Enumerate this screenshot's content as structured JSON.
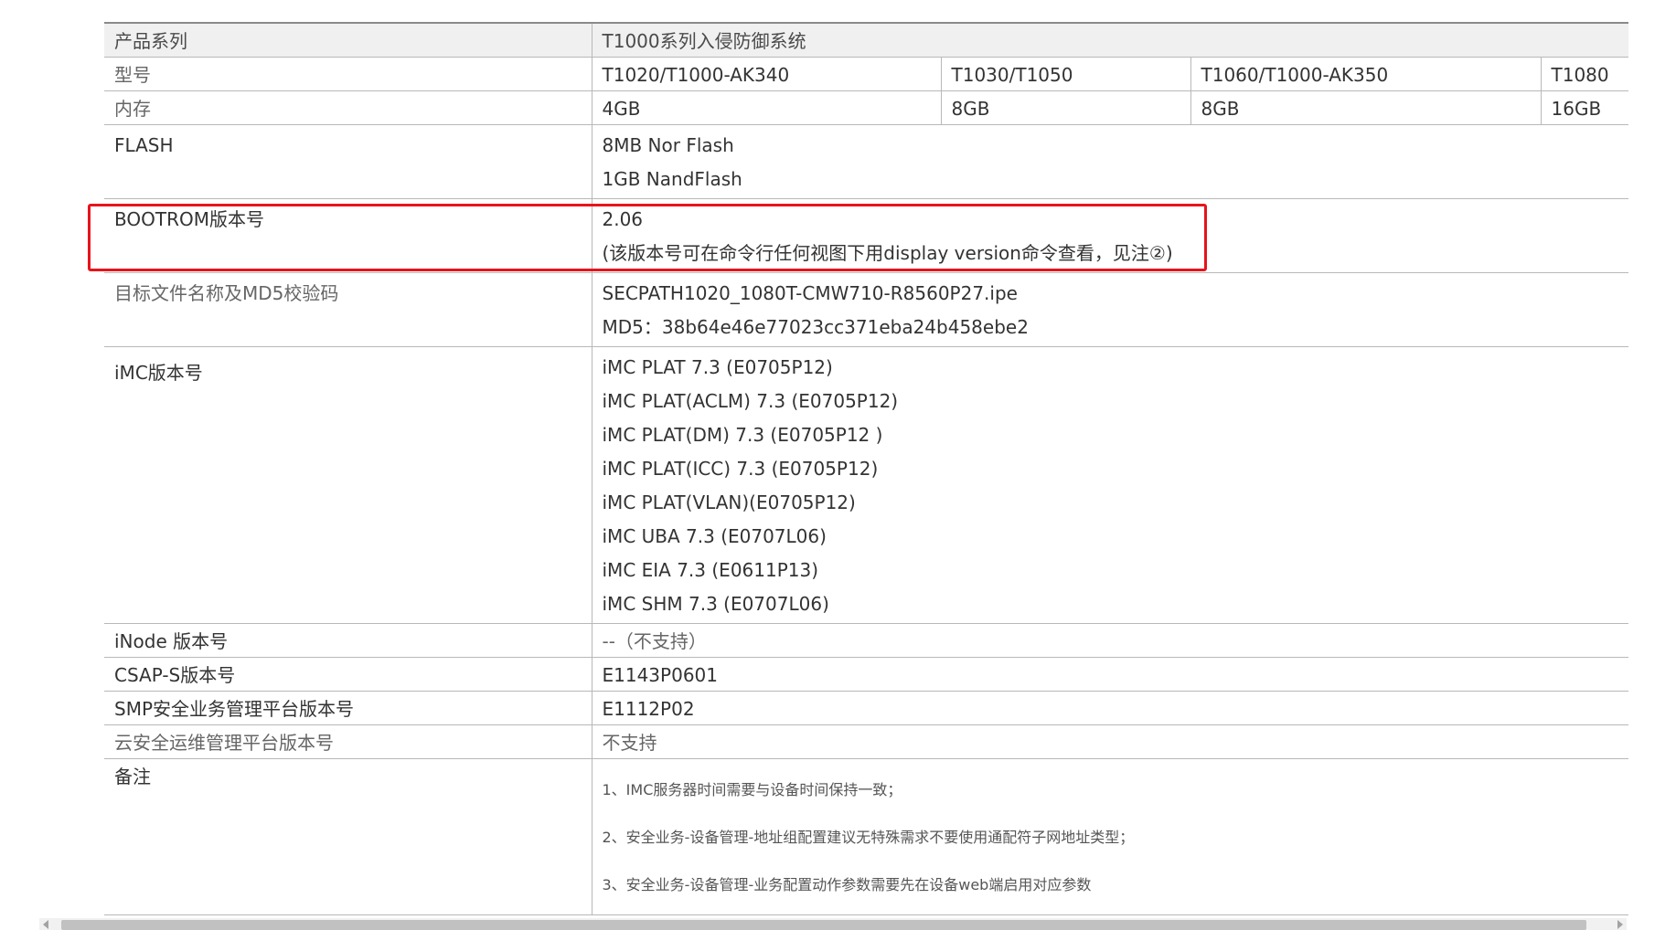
{
  "table": {
    "header": {
      "label": "产品系列",
      "value": "T1000系列入侵防御系统"
    },
    "model": {
      "label": "型号",
      "values": [
        "T1020/T1000-AK340",
        "T1030/T1050",
        "T1060/T1000-AK350",
        "T1080"
      ]
    },
    "memory": {
      "label": "内存",
      "values": [
        "4GB",
        "8GB",
        "8GB",
        "16GB"
      ]
    },
    "flash": {
      "label": "FLASH",
      "lines": [
        "8MB Nor Flash",
        "1GB NandFlash"
      ]
    },
    "bootrom": {
      "label": "BOOTROM版本号",
      "lines": [
        "2.06",
        "(该版本号可在命令行任何视图下用display version命令查看，见注②)"
      ]
    },
    "target_file": {
      "label": "目标文件名称及MD5校验码",
      "lines": [
        "SECPATH1020_1080T-CMW710-R8560P27.ipe",
        "MD5：38b64e46e77023cc371eba24b458ebe2"
      ]
    },
    "imc": {
      "label": "iMC版本号",
      "lines": [
        "iMC PLAT 7.3 (E0705P12)",
        "iMC PLAT(ACLM) 7.3 (E0705P12)",
        "iMC PLAT(DM) 7.3 (E0705P12 )",
        "iMC PLAT(ICC) 7.3 (E0705P12)",
        "iMC PLAT(VLAN)(E0705P12)",
        "iMC UBA 7.3 (E0707L06)",
        "iMC EIA 7.3 (E0611P13)",
        "iMC SHM 7.3 (E0707L06)"
      ]
    },
    "inode": {
      "label": "iNode 版本号",
      "value": "--（不支持）"
    },
    "csap": {
      "label": "CSAP-S版本号",
      "value": "E1143P0601"
    },
    "smp": {
      "label": "SMP安全业务管理平台版本号",
      "value": "E1112P02"
    },
    "cloud": {
      "label": "云安全运维管理平台版本号",
      "value": "不支持"
    },
    "notes": {
      "label": "备注",
      "lines": [
        "1、IMC服务器时间需要与设备时间保持一致；",
        "2、安全业务-设备管理-地址组配置建议无特殊需求不要使用通配符子网地址类型；",
        "3、安全业务-设备管理-业务配置动作参数需要先在设备web端启用对应参数"
      ]
    }
  },
  "colors": {
    "highlight_border": "#e8131b",
    "header_background": "#f0f0f0",
    "grid_line": "#b8b8b8",
    "scrollbar_thumb": "#c1c1c1"
  }
}
